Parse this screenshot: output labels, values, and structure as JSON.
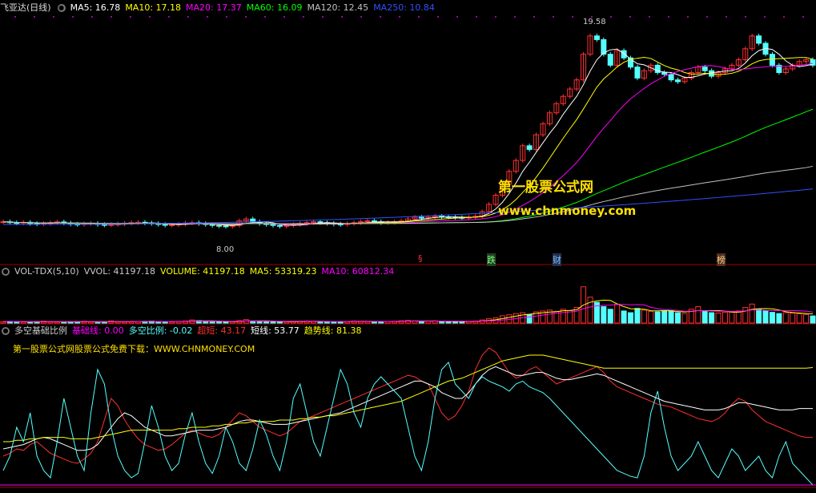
{
  "main_header": {
    "title": "飞亚达(日线)",
    "ma5": "MA5: 16.78",
    "ma10": "MA10: 17.18",
    "ma20": "MA20: 17.37",
    "ma60": "MA60: 16.09",
    "ma120": "MA120: 12.45",
    "ma250": "MA250: 10.84"
  },
  "vol_header": {
    "title": "VOL-TDX(5,10)",
    "vvol": "VVOL: 41197.18",
    "volume": "VOLUME: 41197.18",
    "ma5": "MA5: 53319.23",
    "ma10": "MA10: 60812.34"
  },
  "ind_header": {
    "title": "多空基础比例",
    "base": "基础线: 0.00",
    "ratio": "多空比例: -0.02",
    "over": "超短: 43.17",
    "short": "短线: 53.77",
    "trend": "趋势线: 81.38"
  },
  "watermark": {
    "line1": "第一股票公式网",
    "line2": "www.chnmoney.com"
  },
  "indicator_note": "第一股票公式网股票公式免费下载：WWW.CHNMONEY.COM",
  "events": [
    "§",
    "跌",
    "财",
    "榜"
  ],
  "price_labels": {
    "high": "19.58",
    "low": "8.00"
  },
  "colors": {
    "up": "#ff3030",
    "down": "#54ffff",
    "ma5": "#ffffff",
    "ma10": "#ffff00",
    "ma20": "#ff00ff",
    "ma60": "#00ff00",
    "ma120": "#c0c0c0",
    "ma250": "#3050ff"
  },
  "chart_data": [
    {
      "type": "candlestick",
      "title": "飞亚达(日线)",
      "x_count": 121,
      "ylim": [
        7.5,
        20.2
      ],
      "high_label": 19.58,
      "low_label": 8.0,
      "closes": [
        9.05,
        9.0,
        8.98,
        9.02,
        8.95,
        8.93,
        8.96,
        9.0,
        9.04,
        8.98,
        8.92,
        8.9,
        8.94,
        8.96,
        8.9,
        8.87,
        8.9,
        8.93,
        8.97,
        9.0,
        9.02,
        8.98,
        8.95,
        8.9,
        8.86,
        8.88,
        8.92,
        8.98,
        9.0,
        8.95,
        8.9,
        8.85,
        8.82,
        8.8,
        8.85,
        9.1,
        9.2,
        9.05,
        8.95,
        8.9,
        8.85,
        8.8,
        8.85,
        8.9,
        8.95,
        9.0,
        9.05,
        9.0,
        8.96,
        8.92,
        8.9,
        8.95,
        9.0,
        9.05,
        9.1,
        9.05,
        9.0,
        9.02,
        9.05,
        9.1,
        9.2,
        9.3,
        9.25,
        9.3,
        9.35,
        9.32,
        9.3,
        9.28,
        9.25,
        9.3,
        9.35,
        9.6,
        10.0,
        10.5,
        11.1,
        11.8,
        12.4,
        13.2,
        13.0,
        13.8,
        14.4,
        15.0,
        15.5,
        15.9,
        16.3,
        16.8,
        18.2,
        19.2,
        19.0,
        18.2,
        17.6,
        18.4,
        18.0,
        17.5,
        16.9,
        17.3,
        17.6,
        17.2,
        17.1,
        16.8,
        16.7,
        16.9,
        17.2,
        17.5,
        17.3,
        17.0,
        17.2,
        17.4,
        17.6,
        17.9,
        18.5,
        19.2,
        18.8,
        18.2,
        17.6,
        17.2,
        17.4,
        17.6,
        17.8,
        17.9,
        17.6
      ],
      "ma_last": {
        "MA5": 16.78,
        "MA10": 17.18,
        "MA20": 17.37,
        "MA60": 16.09,
        "MA120": 12.45,
        "MA250": 10.84
      }
    },
    {
      "type": "bar",
      "title": "VOL-TDX(5,10)",
      "ylim": [
        0,
        260000
      ],
      "volumes": [
        8,
        10,
        9,
        7,
        6,
        9,
        11,
        8,
        7,
        6,
        8,
        9,
        10,
        7,
        6,
        8,
        12,
        9,
        7,
        8,
        9,
        10,
        11,
        9,
        8,
        7,
        10,
        12,
        18,
        14,
        10,
        9,
        8,
        7,
        9,
        14,
        20,
        12,
        10,
        9,
        8,
        7,
        9,
        10,
        11,
        12,
        10,
        9,
        8,
        7,
        9,
        10,
        12,
        11,
        9,
        8,
        9,
        10,
        11,
        13,
        15,
        12,
        10,
        11,
        12,
        10,
        9,
        8,
        9,
        10,
        12,
        18,
        25,
        30,
        42,
        48,
        55,
        60,
        50,
        65,
        70,
        75,
        68,
        80,
        72,
        90,
        210,
        150,
        120,
        95,
        80,
        110,
        70,
        60,
        85,
        75,
        68,
        65,
        70,
        72,
        60,
        55,
        80,
        95,
        70,
        60,
        58,
        62,
        66,
        70,
        90,
        110,
        80,
        70,
        62,
        55,
        60,
        58,
        54,
        50,
        41.2
      ],
      "volume_unit_scale": 1000,
      "last": {
        "VOLUME": 41197.18,
        "MA5": 53319.23,
        "MA10": 60812.34
      }
    },
    {
      "type": "line",
      "title": "多空基础比例",
      "ylim": [
        0,
        100
      ],
      "series": [
        {
          "name": "超短",
          "values": [
            20,
            22,
            25,
            24,
            28,
            30,
            26,
            22,
            20,
            18,
            16,
            15,
            18,
            22,
            30,
            45,
            60,
            55,
            45,
            38,
            32,
            28,
            26,
            24,
            25,
            28,
            32,
            36,
            38,
            36,
            34,
            33,
            35,
            40,
            45,
            50,
            48,
            44,
            40,
            38,
            36,
            34,
            36,
            40,
            44,
            46,
            48,
            50,
            52,
            54,
            56,
            58,
            60,
            62,
            64,
            66,
            68,
            70,
            72,
            74,
            76,
            75,
            72,
            70,
            60,
            50,
            45,
            48,
            55,
            65,
            80,
            90,
            95,
            92,
            85,
            78,
            74,
            76,
            80,
            82,
            78,
            74,
            70,
            72,
            74,
            76,
            78,
            80,
            82,
            78,
            72,
            68,
            66,
            64,
            62,
            60,
            58,
            56,
            55,
            54,
            52,
            50,
            48,
            46,
            45,
            44,
            46,
            50,
            56,
            60,
            58,
            52,
            48,
            44,
            42,
            40,
            38,
            36,
            34,
            33,
            33
          ]
        },
        {
          "name": "短线",
          "values": [
            25,
            26,
            27,
            28,
            30,
            32,
            33,
            32,
            30,
            28,
            26,
            24,
            24,
            25,
            28,
            34,
            40,
            46,
            50,
            48,
            44,
            40,
            38,
            36,
            34,
            34,
            35,
            36,
            37,
            38,
            38,
            38,
            39,
            40,
            42,
            44,
            45,
            45,
            44,
            43,
            42,
            42,
            42,
            43,
            44,
            45,
            46,
            47,
            48,
            49,
            50,
            52,
            54,
            56,
            58,
            60,
            62,
            64,
            66,
            68,
            70,
            72,
            72,
            70,
            68,
            64,
            62,
            60,
            60,
            64,
            70,
            76,
            80,
            82,
            80,
            78,
            76,
            76,
            77,
            78,
            78,
            76,
            74,
            73,
            73,
            74,
            75,
            76,
            77,
            76,
            74,
            72,
            70,
            68,
            66,
            64,
            62,
            60,
            58,
            57,
            56,
            55,
            54,
            53,
            52,
            52,
            52,
            53,
            55,
            57,
            57,
            56,
            55,
            54,
            53,
            52,
            52,
            52,
            53,
            53,
            53
          ]
        },
        {
          "name": "趋势线",
          "values": [
            30,
            30,
            31,
            31,
            32,
            32,
            33,
            33,
            33,
            33,
            32,
            32,
            32,
            32,
            33,
            34,
            35,
            36,
            37,
            38,
            38,
            38,
            38,
            38,
            38,
            38,
            39,
            39,
            40,
            40,
            40,
            41,
            41,
            42,
            42,
            43,
            43,
            44,
            44,
            44,
            44,
            45,
            45,
            45,
            46,
            46,
            47,
            47,
            48,
            48,
            49,
            50,
            51,
            52,
            53,
            54,
            55,
            56,
            57,
            58,
            60,
            62,
            64,
            66,
            68,
            70,
            72,
            73,
            74,
            76,
            78,
            80,
            82,
            84,
            86,
            87,
            88,
            89,
            90,
            90,
            90,
            89,
            88,
            87,
            86,
            85,
            84,
            83,
            82,
            81,
            81,
            81,
            81,
            81,
            81,
            81,
            81,
            81,
            81,
            81,
            81,
            81,
            81,
            81,
            81,
            81,
            81,
            81,
            81,
            81,
            81,
            81,
            81,
            81,
            81,
            81,
            81,
            81,
            81,
            81,
            81.4
          ]
        },
        {
          "name": "多空比例",
          "values": [
            10,
            20,
            40,
            30,
            50,
            20,
            10,
            5,
            30,
            60,
            40,
            20,
            10,
            50,
            80,
            70,
            40,
            20,
            10,
            5,
            8,
            30,
            55,
            40,
            20,
            10,
            15,
            35,
            50,
            30,
            15,
            8,
            20,
            40,
            30,
            15,
            10,
            25,
            45,
            35,
            20,
            10,
            30,
            60,
            70,
            50,
            30,
            20,
            40,
            60,
            80,
            70,
            50,
            40,
            60,
            70,
            75,
            70,
            65,
            60,
            40,
            20,
            10,
            30,
            60,
            80,
            85,
            70,
            65,
            60,
            70,
            75,
            72,
            70,
            68,
            65,
            70,
            72,
            68,
            66,
            64,
            60,
            55,
            50,
            45,
            40,
            35,
            30,
            25,
            20,
            15,
            10,
            8,
            6,
            5,
            20,
            50,
            65,
            40,
            20,
            10,
            15,
            20,
            30,
            20,
            10,
            5,
            15,
            25,
            20,
            10,
            15,
            20,
            10,
            5,
            20,
            30,
            15,
            10,
            5,
            -0.02
          ]
        }
      ]
    }
  ]
}
